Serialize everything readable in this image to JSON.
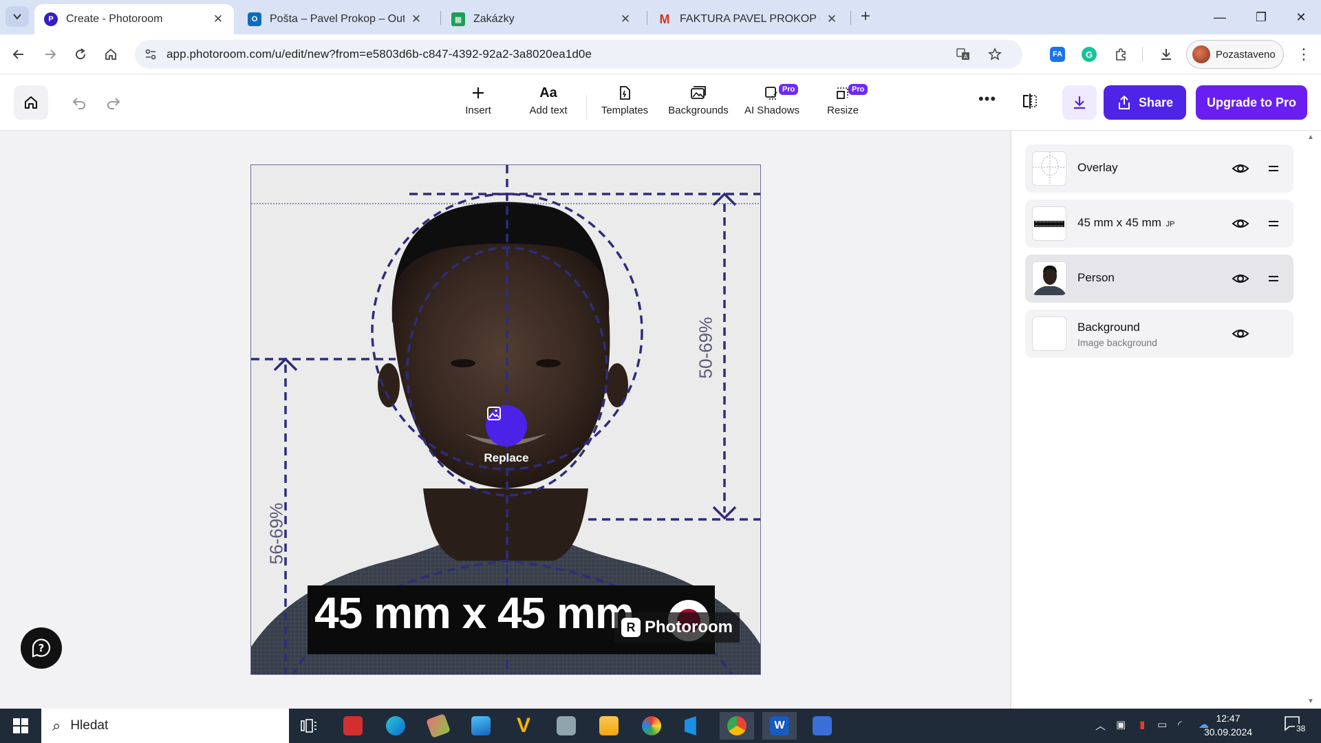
{
  "browser": {
    "tabs": [
      {
        "title": "Create - Photoroom",
        "favicon": "photoroom-icon",
        "active": true
      },
      {
        "title": "Pošta – Pavel Prokop – Outlook",
        "favicon": "outlook-icon",
        "active": false
      },
      {
        "title": "Zakázky",
        "favicon": "sheets-icon",
        "active": false
      },
      {
        "title": "FAKTURA PAVEL PROKOP - pav",
        "favicon": "gmail-icon",
        "active": false
      }
    ],
    "url": "app.photoroom.com/u/edit/new?from=e5803d6b-c847-4392-92a2-3a8020ea1d0e",
    "profile_label": "Pozastaveno",
    "ext_fa_label": "FA"
  },
  "toolbar": {
    "tools": [
      {
        "label": "Insert",
        "icon": "plus-icon",
        "pro": false
      },
      {
        "label": "Add text",
        "icon": "text-icon",
        "icon_text": "Aa",
        "pro": false
      },
      {
        "label": "Templates",
        "icon": "templates-icon",
        "pro": false
      },
      {
        "label": "Backgrounds",
        "icon": "backgrounds-icon",
        "pro": false
      },
      {
        "label": "AI Shadows",
        "icon": "shadow-icon",
        "pro": true
      },
      {
        "label": "Resize",
        "icon": "resize-icon",
        "pro": true
      }
    ],
    "pro_badge": "Pro",
    "share_label": "Share",
    "upgrade_label": "Upgrade to Pro",
    "accent_color": "#4f24e6",
    "upgrade_color": "#6a1ff0"
  },
  "canvas": {
    "replace_label": "Replace",
    "size_text": "45 mm x 45 mm",
    "watermark": "Photoroom",
    "guide_left_label": "56-69%",
    "guide_right_label": "50-69%",
    "guide_color": "#2f2c7a"
  },
  "layers": [
    {
      "name": "Overlay",
      "subtitle": "",
      "thumb": "overlay-thumb",
      "handle": true,
      "selected": false
    },
    {
      "name": "45 mm x 45 mm",
      "suffix": "JP",
      "subtitle": "",
      "thumb": "size-thumb",
      "handle": true,
      "selected": false
    },
    {
      "name": "Person",
      "subtitle": "",
      "thumb": "person-thumb",
      "handle": true,
      "selected": true
    },
    {
      "name": "Background",
      "subtitle": "Image background",
      "thumb": "background-thumb",
      "handle": false,
      "selected": false
    }
  ],
  "taskbar": {
    "search_placeholder": "Hledat",
    "time": "12:47",
    "date": "30.09.2024",
    "notification_count": "38"
  }
}
